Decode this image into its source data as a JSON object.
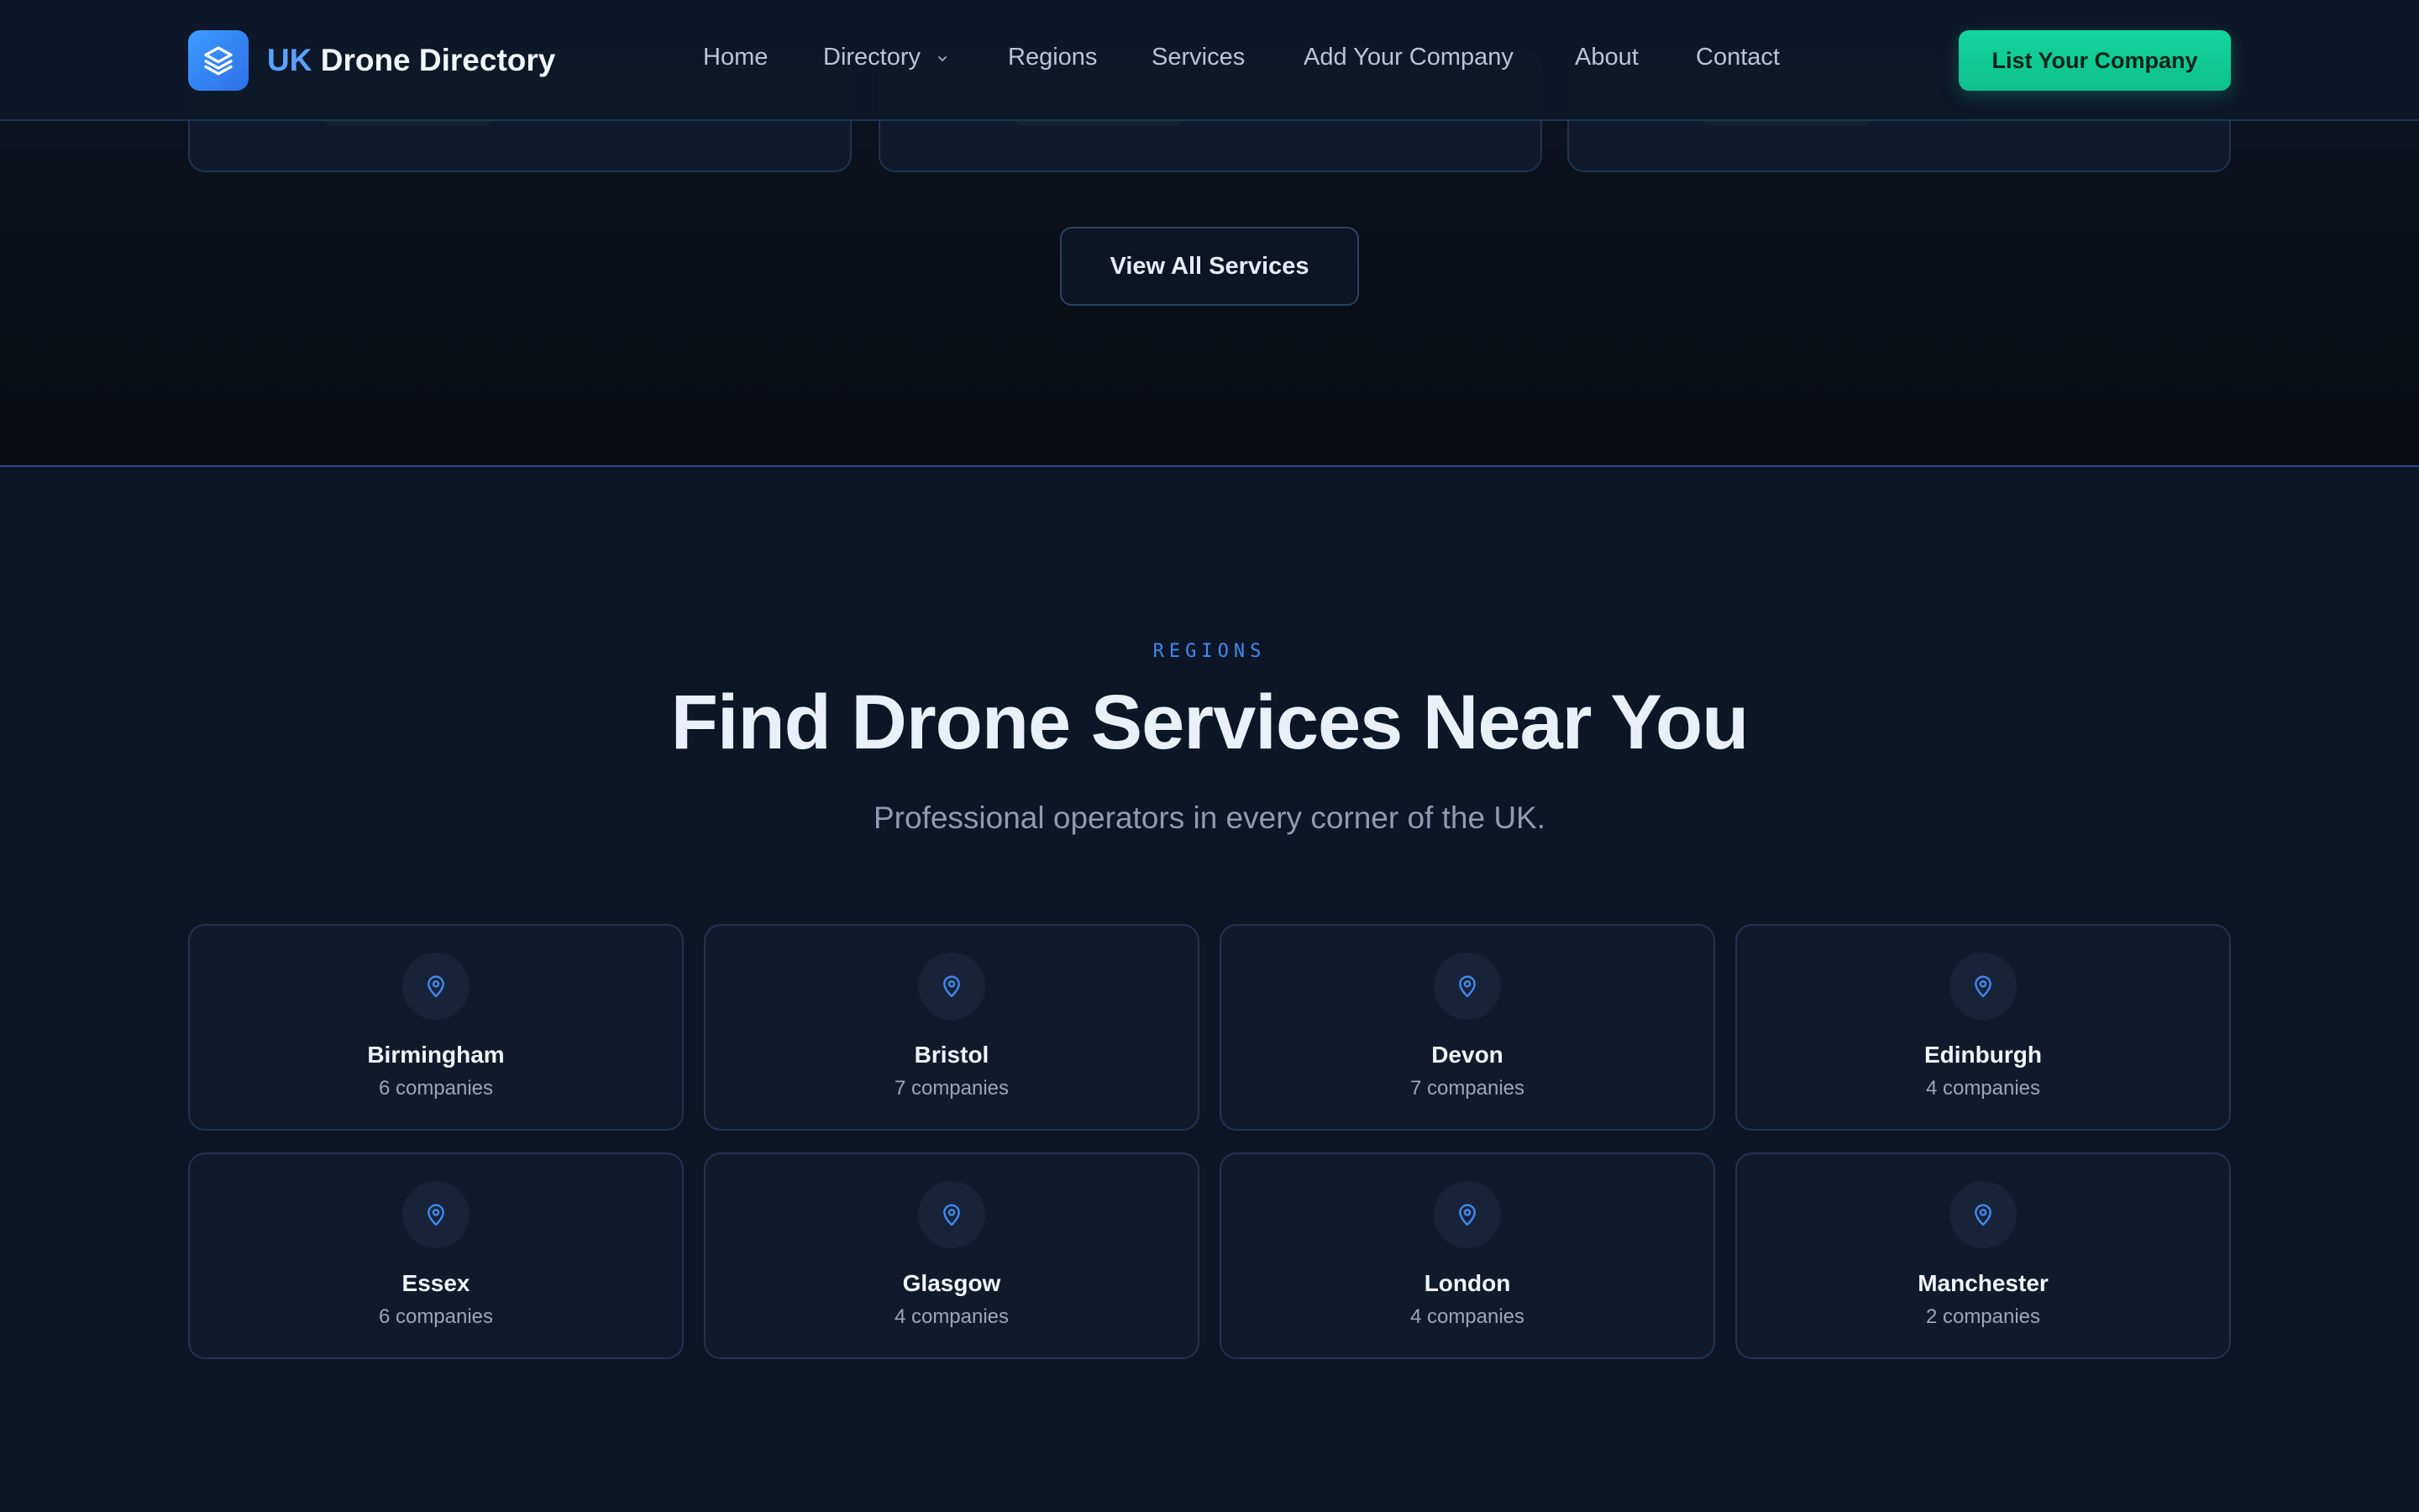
{
  "brand": {
    "prefix": "UK",
    "name": "Drone Directory",
    "icon": "layers-icon"
  },
  "nav": {
    "items": [
      {
        "label": "Home"
      },
      {
        "label": "Directory",
        "has_dropdown": true
      },
      {
        "label": "Regions"
      },
      {
        "label": "Services"
      },
      {
        "label": "Add Your Company"
      },
      {
        "label": "About"
      },
      {
        "label": "Contact"
      }
    ],
    "cta_label": "List Your Company"
  },
  "services": {
    "view_all_label": "View All Services"
  },
  "regions": {
    "eyebrow": "REGIONS",
    "title": "Find Drone Services Near You",
    "subtitle": "Professional operators in every corner of the UK.",
    "items": [
      {
        "name": "Birmingham",
        "count": "6 companies"
      },
      {
        "name": "Bristol",
        "count": "7 companies"
      },
      {
        "name": "Devon",
        "count": "7 companies"
      },
      {
        "name": "Edinburgh",
        "count": "4 companies"
      },
      {
        "name": "Essex",
        "count": "6 companies"
      },
      {
        "name": "Glasgow",
        "count": "4 companies"
      },
      {
        "name": "London",
        "count": "4 companies"
      },
      {
        "name": "Manchester",
        "count": "2 companies"
      }
    ]
  },
  "colors": {
    "accent_blue": "#3f8bf0",
    "cta_green": "#12d69e",
    "background": "#0c1627"
  }
}
